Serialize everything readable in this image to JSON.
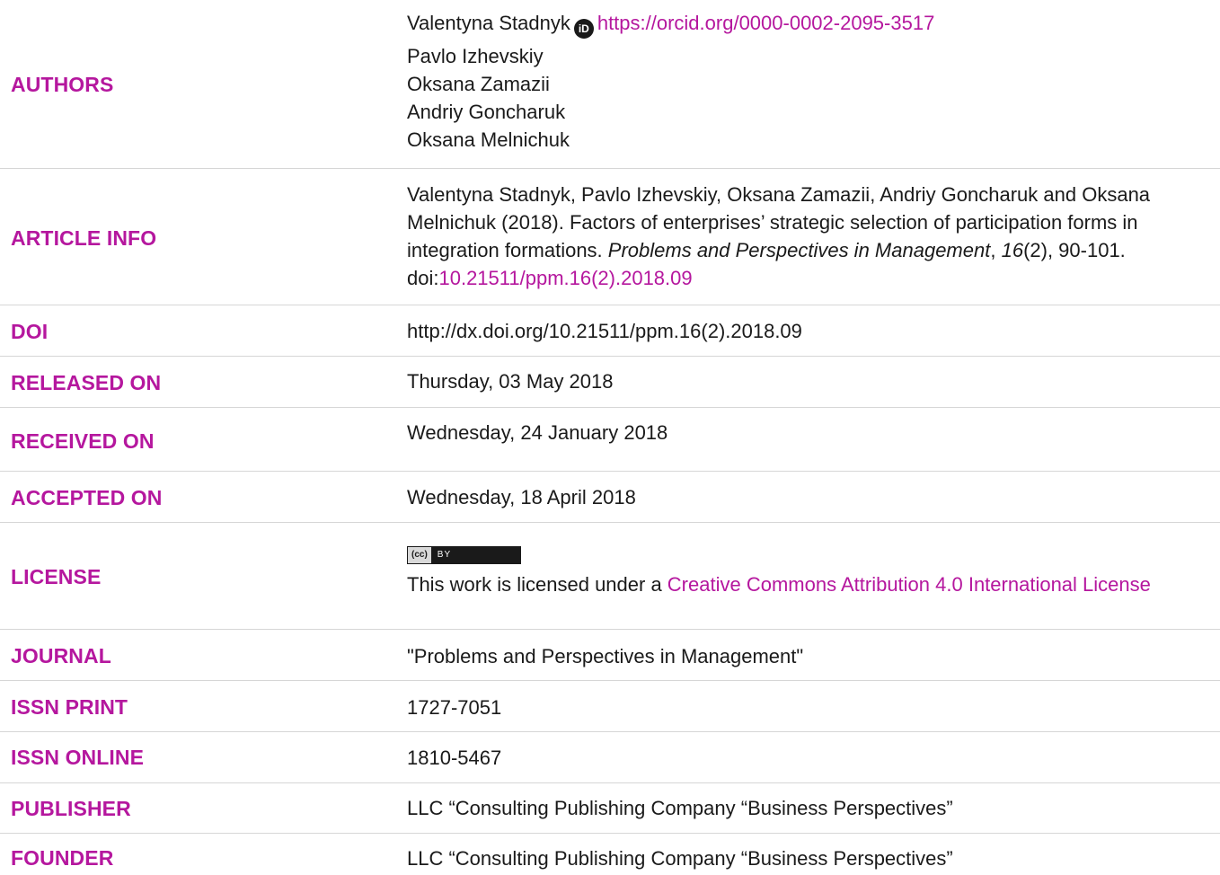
{
  "rows": {
    "authors": {
      "label": "AUTHORS",
      "first_author": "Valentyna Stadnyk",
      "orcid_glyph": "iD",
      "orcid_url": "https://orcid.org/0000-0002-2095-3517",
      "others": [
        "Pavlo Izhevskiy",
        "Oksana Zamazii",
        "Andriy Goncharuk",
        "Oksana Melnichuk"
      ]
    },
    "article_info": {
      "label": "ARTICLE INFO",
      "citation_text": "Valentyna Stadnyk, Pavlo Izhevskiy, Oksana Zamazii, Andriy Goncharuk and Oksana Melnichuk (2018). Factors of enterprises’ strategic selection of participation forms in integration formations. ",
      "journal_italic": "Problems and Perspectives in Management",
      "sep1": ", ",
      "volume_italic": "16",
      "issue_pages": "(2), 90-101. doi:",
      "doi_link": "10.21511/ppm.16(2).2018.09"
    },
    "doi": {
      "label": "DOI",
      "value": "http://dx.doi.org/10.21511/ppm.16(2).2018.09"
    },
    "released": {
      "label": "RELEASED ON",
      "value": "Thursday, 03 May 2018"
    },
    "received": {
      "label": "RECEIVED ON",
      "value": "Wednesday, 24 January 2018"
    },
    "accepted": {
      "label": "ACCEPTED ON",
      "value": "Wednesday, 18 April 2018"
    },
    "license": {
      "label": "LICENSE",
      "badge_cc": "(cc)",
      "badge_by": "BY",
      "text_prefix": "This work is licensed under a ",
      "link_text": "Creative Commons Attribution 4.0 International License"
    },
    "journal": {
      "label": "JOURNAL",
      "value": "\"Problems and Perspectives in Management\""
    },
    "issn_print": {
      "label": "ISSN PRINT",
      "value": "1727-7051"
    },
    "issn_online": {
      "label": "ISSN ONLINE",
      "value": "1810-5467"
    },
    "publisher": {
      "label": "PUBLISHER",
      "value": "LLC “Consulting Publishing Company “Business Perspectives”"
    },
    "founder": {
      "label": "FOUNDER",
      "value": "LLC “Consulting Publishing Company “Business Perspectives”"
    }
  },
  "colors": {
    "accent": "#b5179e",
    "text": "#1a1a1a",
    "divider": "#d6d6d6"
  }
}
